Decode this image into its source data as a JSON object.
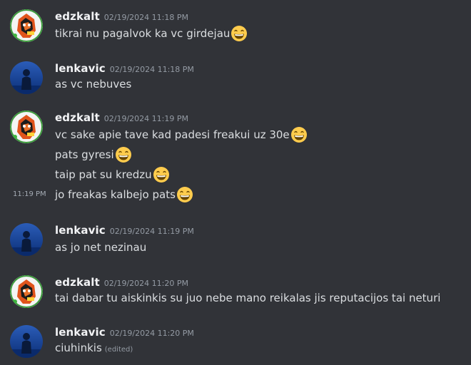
{
  "users": {
    "edzkalt": "edzkalt",
    "lenkavic": "lenkavic"
  },
  "emoji_icon": "grinning-face-emoji",
  "messages": [
    {
      "author": "edzkalt",
      "timestamp": "02/19/2024 11:18 PM",
      "lines": [
        {
          "text": "tikrai nu pagalvok ka vc girdejau",
          "emoji": true
        }
      ]
    },
    {
      "author": "lenkavic",
      "timestamp": "02/19/2024 11:18 PM",
      "lines": [
        {
          "text": "as vc nebuves",
          "emoji": false
        }
      ]
    },
    {
      "author": "edzkalt",
      "timestamp": "02/19/2024 11:19 PM",
      "lines": [
        {
          "text": "vc sake apie tave kad padesi freakui uz 30e",
          "emoji": true
        },
        {
          "text": "pats gyresi",
          "emoji": true
        },
        {
          "text": "taip pat su kredzu",
          "emoji": true
        },
        {
          "text": "jo freakas kalbejo pats",
          "emoji": true,
          "hover_time": "11:19 PM"
        }
      ]
    },
    {
      "author": "lenkavic",
      "timestamp": "02/19/2024 11:19 PM",
      "lines": [
        {
          "text": "as jo net nezinau",
          "emoji": false
        }
      ]
    },
    {
      "author": "edzkalt",
      "timestamp": "02/19/2024 11:20 PM",
      "lines": [
        {
          "text": "tai dabar tu aiskinkis su juo nebe mano reikalas jis reputacijos tai neturi",
          "emoji": false
        }
      ]
    },
    {
      "author": "lenkavic",
      "timestamp": "02/19/2024 11:20 PM",
      "lines": [
        {
          "text": "ciuhinkis",
          "emoji": false,
          "edited": "(edited)"
        }
      ]
    }
  ]
}
